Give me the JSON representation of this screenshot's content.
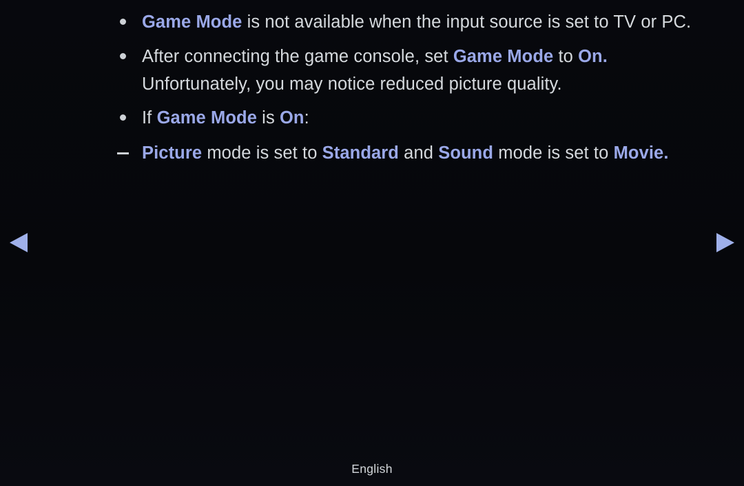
{
  "screen": {
    "background_color": "#06070b",
    "text_color": "#d5d9dd",
    "highlight_color": "#9aa8e8",
    "arrow_color": "#9fb0ea"
  },
  "help_body": {
    "items": [
      {
        "marker": "bullet",
        "lines": [
          {
            "segments": [
              {
                "text": "Game Mode",
                "style": "highlight"
              },
              {
                "text": " is not available when the input source is set to TV or PC.",
                "style": "normal"
              }
            ]
          }
        ]
      },
      {
        "marker": "bullet",
        "lines": [
          {
            "segments": [
              {
                "text": "After connecting the game console, set ",
                "style": "normal"
              },
              {
                "text": "Game Mode",
                "style": "highlight"
              },
              {
                "text": " to ",
                "style": "normal"
              },
              {
                "text": "On",
                "style": "highlight"
              },
              {
                "text": ".",
                "style": "highlight"
              }
            ]
          },
          {
            "segments": [
              {
                "text": "Unfortunately, you may notice reduced picture quality.",
                "style": "normal"
              }
            ]
          }
        ]
      },
      {
        "marker": "bullet",
        "lines": [
          {
            "segments": [
              {
                "text": "If ",
                "style": "normal"
              },
              {
                "text": "Game Mode",
                "style": "highlight"
              },
              {
                "text": " is ",
                "style": "normal"
              },
              {
                "text": "On",
                "style": "highlight"
              },
              {
                "text": ":",
                "style": "normal"
              }
            ]
          }
        ]
      },
      {
        "marker": "dash",
        "lines": [
          {
            "segments": [
              {
                "text": "Picture",
                "style": "highlight"
              },
              {
                "text": " mode is set to ",
                "style": "normal"
              },
              {
                "text": "Standard",
                "style": "highlight"
              },
              {
                "text": " and ",
                "style": "normal"
              },
              {
                "text": "Sound",
                "style": "highlight"
              },
              {
                "text": " mode is set to ",
                "style": "normal"
              },
              {
                "text": "Movie",
                "style": "highlight"
              },
              {
                "text": ".",
                "style": "highlight"
              }
            ]
          }
        ]
      }
    ]
  },
  "navigation": {
    "prev": {
      "icon": "triangle-left-icon",
      "label": "Previous page"
    },
    "next": {
      "icon": "triangle-right-icon",
      "label": "Next page"
    }
  },
  "footer": {
    "language": "English"
  }
}
